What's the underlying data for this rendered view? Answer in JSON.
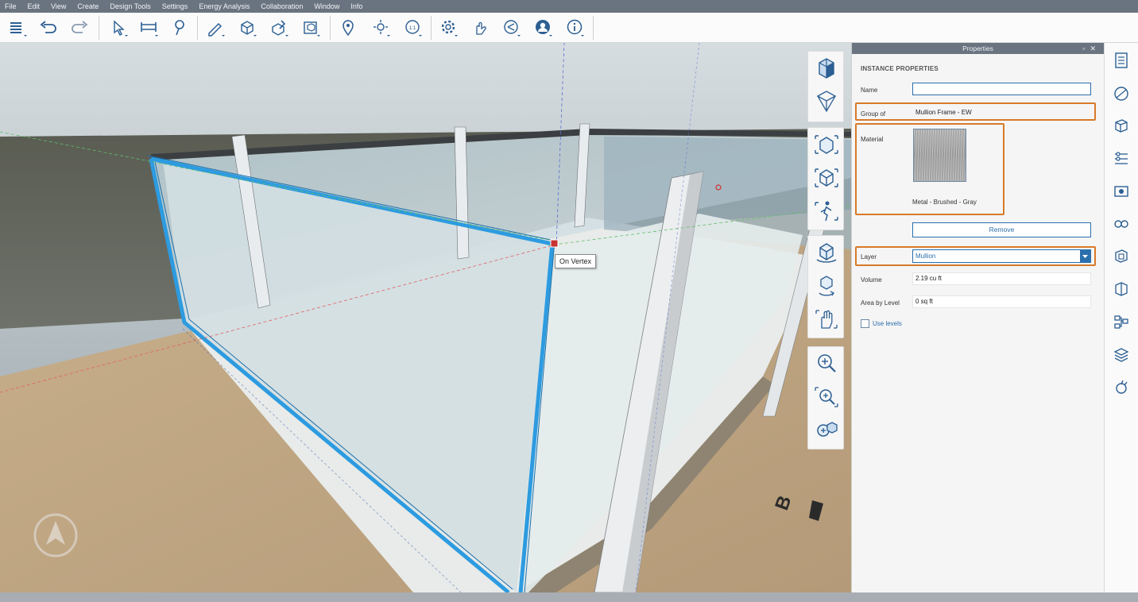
{
  "menu": [
    "File",
    "Edit",
    "View",
    "Create",
    "Design Tools",
    "Settings",
    "Energy Analysis",
    "Collaboration",
    "Window",
    "Info"
  ],
  "toolbar": {
    "icons": [
      "layers-icon",
      "undo-icon",
      "redo-icon",
      "select-icon",
      "measure-icon",
      "search-marker-icon",
      "draw-icon",
      "create-solid-icon",
      "edit-solid-icon",
      "group-icon",
      "location-pin-icon",
      "sun-icon",
      "scale-icon",
      "settings-gear-icon",
      "gesture-hand-icon",
      "share-icon",
      "account-icon",
      "info-icon"
    ]
  },
  "viewport": {
    "tooltip": "On Vertex",
    "grid_label": "B"
  },
  "properties": {
    "panel_title": "Properties",
    "section_title": "INSTANCE PROPERTIES",
    "name_label": "Name",
    "name_value": "",
    "group_label": "Group of",
    "group_value": "Mullion Frame - EW",
    "material_label": "Material",
    "material_name": "Metal - Brushed - Gray",
    "remove_label": "Remove",
    "layer_label": "Layer",
    "layer_value": "Mullion",
    "volume_label": "Volume",
    "volume_value": "2.19 cu ft",
    "area_label": "Area by Level",
    "area_value": "0 sq ft",
    "use_levels_label": "Use levels",
    "use_levels_checked": false
  },
  "colors": {
    "selection": "#2d9be0",
    "highlight": "#d87a2a",
    "accent": "#2c6fad",
    "header": "#6a7480"
  }
}
